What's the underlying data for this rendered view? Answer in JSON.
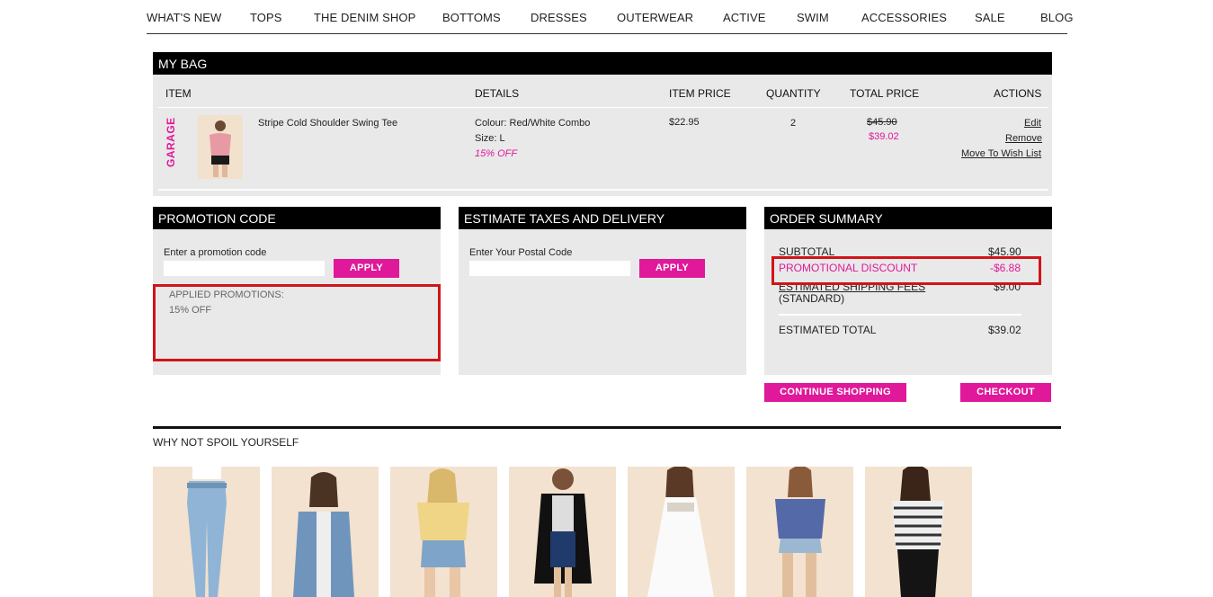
{
  "nav": {
    "items": [
      "WHAT'S NEW",
      "TOPS",
      "THE DENIM SHOP",
      "BOTTOMS",
      "DRESSES",
      "OUTERWEAR",
      "ACTIVE",
      "SWIM",
      "ACCESSORIES",
      "SALE",
      "BLOG"
    ]
  },
  "bag": {
    "title": "MY BAG",
    "columns": {
      "item": "ITEM",
      "details": "DETAILS",
      "item_price": "ITEM PRICE",
      "quantity": "QUANTITY",
      "total_price": "TOTAL PRICE",
      "actions": "ACTIONS"
    },
    "line": {
      "brand": "GARAGE",
      "name": "Stripe Cold Shoulder Swing Tee",
      "colour": "Colour: Red/White Combo",
      "size": "Size: L",
      "discount": "15% OFF",
      "item_price": "$22.95",
      "quantity": "2",
      "original_total": "$45.90",
      "discounted_total": "$39.02",
      "edit": "Edit",
      "remove": "Remove",
      "wishlist": "Move To Wish List"
    }
  },
  "promo": {
    "title": "PROMOTION CODE",
    "label": "Enter a promotion code",
    "apply": "APPLY",
    "applied_label": "APPLIED PROMOTIONS:",
    "applied_value": "15% OFF"
  },
  "taxes": {
    "title": "ESTIMATE TAXES AND DELIVERY",
    "label": "Enter Your Postal Code",
    "apply": "APPLY"
  },
  "summary": {
    "title": "ORDER SUMMARY",
    "subtotal_label": "SUBTOTAL",
    "subtotal": "$45.90",
    "discount_label": "PROMOTIONAL DISCOUNT",
    "discount": "-$6.88",
    "shipping_label": "ESTIMATED SHIPPING FEES",
    "shipping_sub": "(STANDARD)",
    "shipping": "$9.00",
    "total_label": "ESTIMATED TOTAL",
    "total": "$39.02",
    "continue": "CONTINUE SHOPPING",
    "checkout": "CHECKOUT"
  },
  "suggest": {
    "title": "WHY NOT SPOIL YOURSELF"
  },
  "colors": {
    "accent": "#e0189a",
    "highlight": "#d0141a",
    "panel": "#e9e9e9"
  }
}
